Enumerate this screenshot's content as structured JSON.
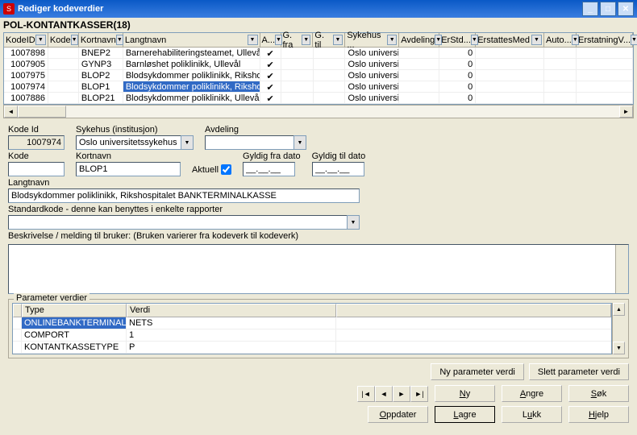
{
  "window": {
    "title": "Rediger kodeverdier"
  },
  "subtitle": "POL-KONTANTKASSER(18)",
  "grid": {
    "headers": [
      "KodeID",
      "Kode",
      "Kortnavn",
      "Langtnavn",
      "A...",
      "G. fra",
      "G. til",
      "Sykehus ...",
      "Avdeling",
      "ErStd...",
      "ErstattesMed",
      "Auto...",
      "ErstatningV..."
    ],
    "rows": [
      {
        "kodeid": "1007898",
        "kode": "",
        "kortnavn": "BNEP2",
        "langtnavn": "Barnerehabiliteringsteamet, Ullevål",
        "a": true,
        "sykehus": "Oslo universite",
        "erstd": "0"
      },
      {
        "kodeid": "1007905",
        "kode": "",
        "kortnavn": "GYNP3",
        "langtnavn": "Barnløshet poliklinikk, Ullevål",
        "a": true,
        "sykehus": "Oslo universite",
        "erstd": "0"
      },
      {
        "kodeid": "1007975",
        "kode": "",
        "kortnavn": "BLOP2",
        "langtnavn": "Blodsykdommer poliklinikk, Rikshospitalet",
        "a": true,
        "sykehus": "Oslo universite",
        "erstd": "0"
      },
      {
        "kodeid": "1007974",
        "kode": "",
        "kortnavn": "BLOP1",
        "langtnavn": "Blodsykdommer poliklinikk, Rikshospitalet BAN",
        "a": true,
        "sykehus": "Oslo universite",
        "erstd": "0",
        "selected": true
      },
      {
        "kodeid": "1007886",
        "kode": "",
        "kortnavn": "BLOP21",
        "langtnavn": "Blodsykdommer poliklinikk, Ullevål",
        "a": true,
        "sykehus": "Oslo universite",
        "erstd": "0"
      }
    ]
  },
  "form": {
    "kodeid_label": "Kode Id",
    "kodeid": "1007974",
    "sykehus_label": "Sykehus (institusjon)",
    "sykehus": "Oslo universitetssykehus",
    "avdeling_label": "Avdeling",
    "avdeling": "",
    "kode_label": "Kode",
    "kode": "",
    "kortnavn_label": "Kortnavn",
    "kortnavn": "BLOP1",
    "aktuell_label": "Aktuell",
    "aktuell": true,
    "gfra_label": "Gyldig fra dato",
    "gfra": "__.__.__",
    "gtil_label": "Gyldig til dato",
    "gtil": "__.__.__",
    "langtnavn_label": "Langtnavn",
    "langtnavn": "Blodsykdommer poliklinikk, Rikshospitalet BANKTERMINALKASSE",
    "stdkode_label": "Standardkode - denne kan benyttes i enkelte rapporter",
    "stdkode": "",
    "beskrivelse_label": "Beskrivelse / melding til bruker: (Bruken varierer fra kodeverk til kodeverk)"
  },
  "params": {
    "title": "Parameter verdier",
    "headers": [
      "Type",
      "Verdi"
    ],
    "rows": [
      {
        "type": "ONLINEBANKTERMINAL",
        "verdi": "NETS",
        "selected": true
      },
      {
        "type": "COMPORT",
        "verdi": "1"
      },
      {
        "type": "KONTANTKASSETYPE",
        "verdi": "P"
      }
    ]
  },
  "buttons": {
    "ny_param": "Ny parameter verdi",
    "slett_param": "Slett parameter verdi",
    "ny": "Ny",
    "angre": "Angre",
    "sok": "Søk",
    "oppdater": "Oppdater",
    "lagre": "Lagre",
    "lukk": "Lukk",
    "hjelp": "Hjelp"
  }
}
